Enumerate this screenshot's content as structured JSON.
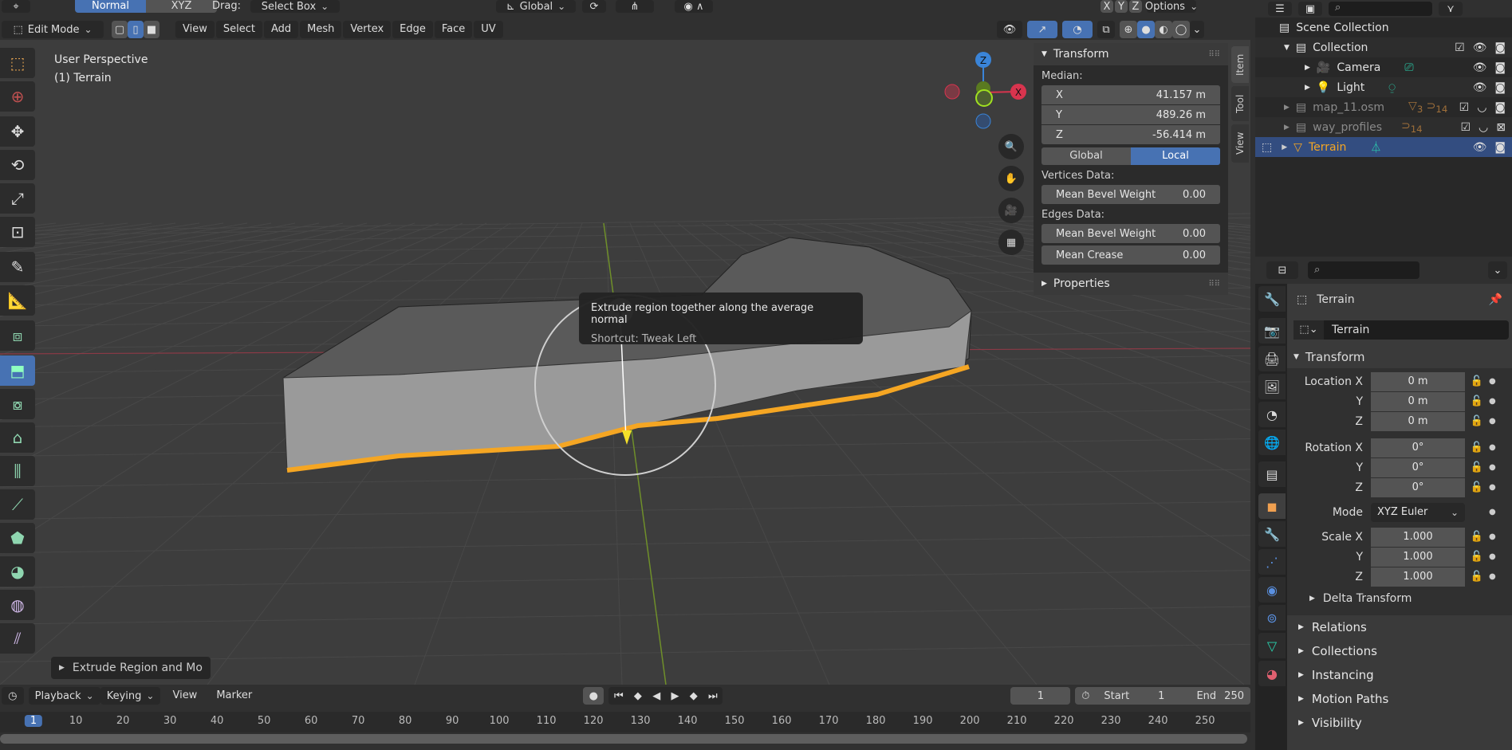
{
  "header": {
    "mode_buttons": [
      "Normal",
      "XYZ"
    ],
    "drag_label": "Drag:",
    "drag_value": "Select Box",
    "orientation": "Global",
    "axis_buttons": [
      "X",
      "Y",
      "Z"
    ],
    "options": "Options"
  },
  "editor_header": {
    "mode": "Edit Mode",
    "menus": [
      "View",
      "Select",
      "Add",
      "Mesh",
      "Vertex",
      "Edge",
      "Face",
      "UV"
    ]
  },
  "viewport": {
    "overlay_title": "User Perspective",
    "overlay_subtitle": "(1) Terrain",
    "tooltip_title": "Extrude region together along the average normal",
    "tooltip_shortcut": "Shortcut: Tweak Left",
    "last_op": "Extrude Region and Mo",
    "gizmo_axes": [
      "Z",
      "Y",
      "X"
    ],
    "tools": [
      "select-box",
      "cursor",
      "move",
      "rotate",
      "scale",
      "transform",
      "annotate",
      "measure",
      "add-cube",
      "extrude-region",
      "inset-faces",
      "bevel",
      "loop-cut",
      "knife",
      "poly-build",
      "spin",
      "smooth",
      "edge-slide"
    ],
    "active_tool_index": 9
  },
  "npanel": {
    "title": "Transform",
    "median_label": "Median:",
    "median": [
      {
        "axis": "X",
        "value": "41.157 m"
      },
      {
        "axis": "Y",
        "value": "489.26 m"
      },
      {
        "axis": "Z",
        "value": "-56.414 m"
      }
    ],
    "space": [
      "Global",
      "Local"
    ],
    "space_active": "Local",
    "vertices_label": "Vertices Data:",
    "vertices": [
      {
        "name": "Mean Bevel Weight",
        "value": "0.00"
      }
    ],
    "edges_label": "Edges Data:",
    "edges": [
      {
        "name": "Mean Bevel Weight",
        "value": "0.00"
      },
      {
        "name": "Mean Crease",
        "value": "0.00"
      }
    ],
    "properties_label": "Properties",
    "tabs": [
      "Item",
      "Tool",
      "View"
    ]
  },
  "outliner": {
    "root": "Scene Collection",
    "items": [
      {
        "name": "Collection",
        "level": 1,
        "expanded": true
      },
      {
        "name": "Camera",
        "level": 2
      },
      {
        "name": "Light",
        "level": 2
      },
      {
        "name": "map_11.osm",
        "level": 1,
        "badges": [
          "3",
          "14"
        ],
        "dim": true
      },
      {
        "name": "way_profiles",
        "level": 1,
        "badges": [
          "14"
        ],
        "dim": true
      },
      {
        "name": "Terrain",
        "level": 1,
        "selected": true
      }
    ]
  },
  "properties": {
    "object_name": "Terrain",
    "datablock_name": "Terrain",
    "transform_label": "Transform",
    "location": {
      "label": "Location X",
      "values": [
        "0 m",
        "0 m",
        "0 m"
      ]
    },
    "rotation": {
      "label": "Rotation X",
      "values": [
        "0°",
        "0°",
        "0°"
      ]
    },
    "mode_label": "Mode",
    "mode_value": "XYZ Euler",
    "scale": {
      "label": "Scale X",
      "values": [
        "1.000",
        "1.000",
        "1.000"
      ]
    },
    "axis_labels": [
      "Y",
      "Z"
    ],
    "delta": "Delta Transform",
    "sections": [
      "Relations",
      "Collections",
      "Instancing",
      "Motion Paths",
      "Visibility"
    ]
  },
  "timeline": {
    "menus": [
      "Playback",
      "Keying",
      "View",
      "Marker"
    ],
    "current_frame": "1",
    "start_label": "Start",
    "start": "1",
    "end_label": "End",
    "end": "250",
    "ruler": [
      "1",
      "10",
      "20",
      "30",
      "40",
      "50",
      "60",
      "70",
      "80",
      "90",
      "100",
      "110",
      "120",
      "130",
      "140",
      "150",
      "160",
      "170",
      "180",
      "190",
      "200",
      "210",
      "220",
      "230",
      "240",
      "250"
    ]
  }
}
